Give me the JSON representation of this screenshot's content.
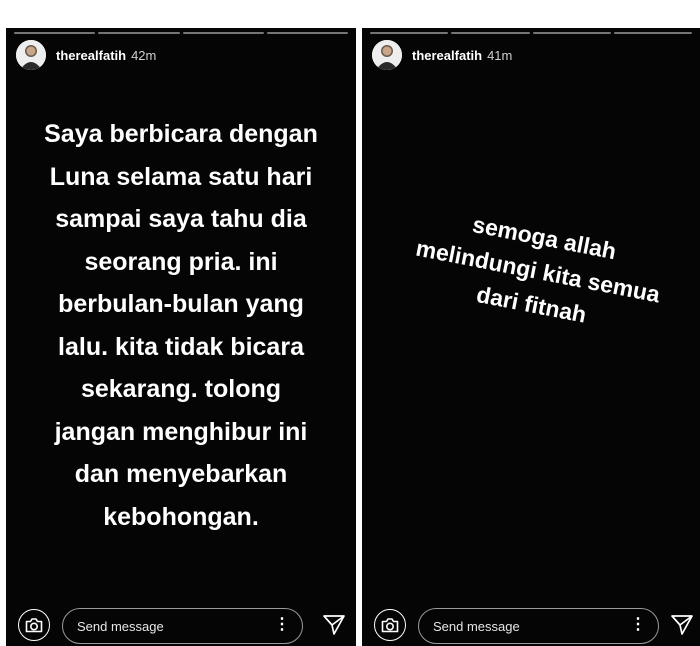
{
  "stories": [
    {
      "username": "therealfatih",
      "time": "42m",
      "caption_lines": [
        "Saya berbicara dengan",
        "Luna selama satu hari",
        "sampai saya tahu dia",
        "seorang pria. ini",
        "berbulan-bulan yang",
        "lalu. kita tidak bicara",
        "sekarang. tolong",
        "jangan menghibur ini",
        "dan menyebarkan",
        "kebohongan."
      ],
      "reply_placeholder": "Send message",
      "more_glyph": "⋮"
    },
    {
      "username": "therealfatih",
      "time": "41m",
      "caption_lines": [
        "semoga allah",
        "melindungi kita semua",
        "dari fitnah"
      ],
      "reply_placeholder": "Send message",
      "more_glyph": "⋮"
    }
  ],
  "icons": [
    "avatar",
    "camera-icon",
    "more-options-icon",
    "direct-share-icon"
  ],
  "colors": {
    "story_background": "#050505",
    "text": "#ffffff",
    "page_background": "#ffffff"
  }
}
